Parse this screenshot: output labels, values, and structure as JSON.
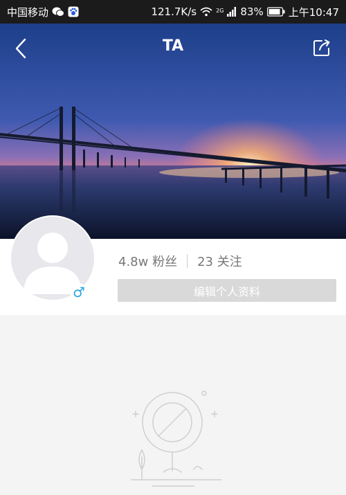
{
  "status_bar": {
    "carrier": "中国移动",
    "speed": "121.7K/s",
    "network_badge": "2G",
    "battery": "83%",
    "time": "上午10:47"
  },
  "header": {
    "title": "TA"
  },
  "profile": {
    "fans": "4.8w 粉丝",
    "following": "23 关注",
    "edit_label": "编辑个人资料",
    "gender_symbol": "♂"
  }
}
